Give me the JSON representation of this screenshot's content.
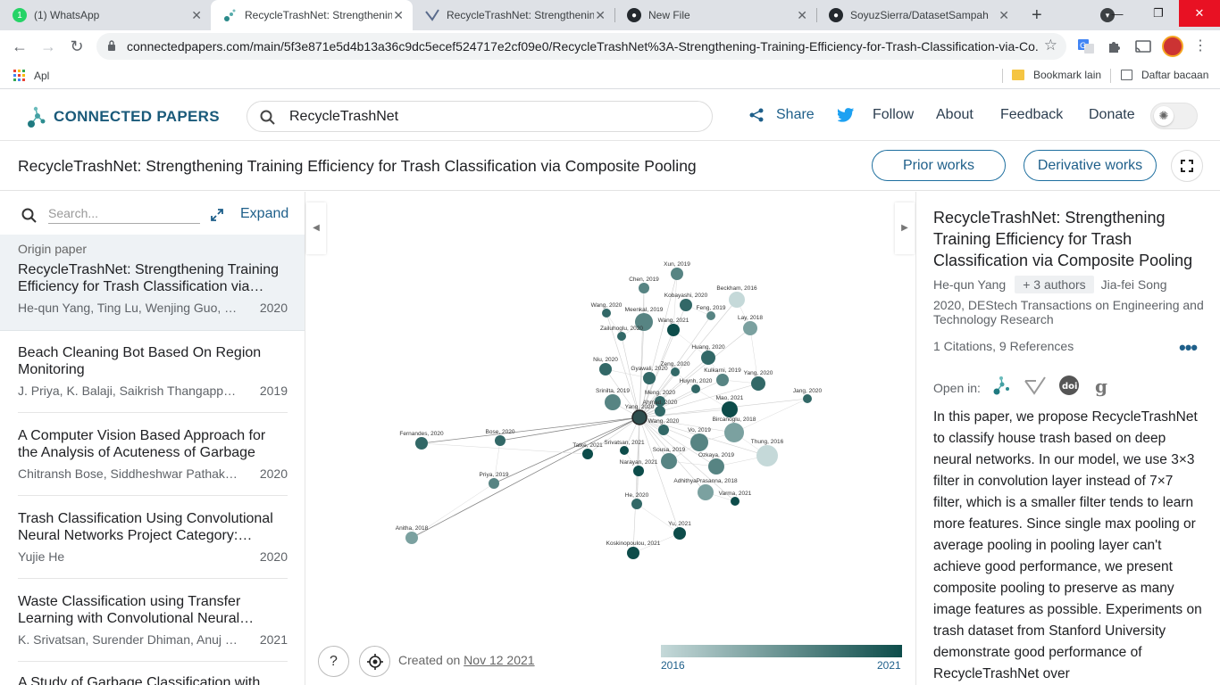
{
  "browser": {
    "tabs": [
      {
        "title": "(1) WhatsApp",
        "badge": "1"
      },
      {
        "title": "RecycleTrashNet: Strengthening"
      },
      {
        "title": "RecycleTrashNet: Strengthening"
      },
      {
        "title": "New File"
      },
      {
        "title": "SoyuzSierra/DatasetSampah"
      }
    ],
    "url": "connectedpapers.com/main/5f3e871e5d4b13a36c9dc5ecef524717e2cf09e0/RecycleTrashNet%3A-Strengthening-Training-Efficiency-for-Trash-Classification-via-Co...",
    "bookmarks": {
      "apps": "Apl",
      "other": "Bookmark lain",
      "reading": "Daftar bacaan"
    }
  },
  "header": {
    "logo": "CONNECTED PAPERS",
    "search_value": "RecycleTrashNet",
    "nav": {
      "share": "Share",
      "follow": "Follow",
      "about": "About",
      "feedback": "Feedback",
      "donate": "Donate"
    }
  },
  "titlebar": {
    "paper_title": "RecycleTrashNet: Strengthening Training Efficiency for Trash Classification via Composite Pooling",
    "prior": "Prior works",
    "derivative": "Derivative works"
  },
  "list": {
    "search_placeholder": "Search...",
    "expand": "Expand",
    "origin_label": "Origin paper",
    "origin": {
      "title": "RecycleTrashNet: Strengthening Training Efficiency for Trash Classification via…",
      "authors": "He-qun Yang, Ting Lu, Wenjing Guo, Shan…",
      "year": "2020"
    },
    "items": [
      {
        "title": "Beach Cleaning Bot Based On Region Monitoring",
        "authors": "J. Priya, K. Balaji, Saikrish Thangappan, G.…",
        "year": "2019"
      },
      {
        "title": "A Computer Vision Based Approach for the Analysis of Acuteness of Garbage",
        "authors": "Chitransh Bose, Siddheshwar Pathak, R.…",
        "year": "2020"
      },
      {
        "title": "Trash Classification Using Convolutional Neural Networks Project Category:…",
        "authors": "Yujie He",
        "year": "2020"
      },
      {
        "title": "Waste Classification using Transfer Learning with Convolutional Neural…",
        "authors": "K. Srivatsan, Surender Dhiman, Anuj K. Jain",
        "year": "2021"
      },
      {
        "title": "A Study of Garbage Classification with",
        "authors": "",
        "year": ""
      }
    ]
  },
  "graph": {
    "created_prefix": "Created on",
    "created_date": "Nov 12 2021",
    "legend_min": "2016",
    "legend_max": "2021",
    "nodes": [
      {
        "label": "Xun, 2019",
        "year": 2019
      },
      {
        "label": "Chen, 2019",
        "year": 2019
      },
      {
        "label": "Beckham, 2016",
        "year": 2016
      },
      {
        "label": "Kobayashi, 2020",
        "year": 2020
      },
      {
        "label": "Wang, 2020",
        "year": 2020
      },
      {
        "label": "Meenkal, 2019",
        "year": 2019
      },
      {
        "label": "Feng, 2019",
        "year": 2019
      },
      {
        "label": "Wang, 2021",
        "year": 2021
      },
      {
        "label": "Lay, 2018",
        "year": 2018
      },
      {
        "label": "Zailuhoglu, 2020",
        "year": 2020
      },
      {
        "label": "Huang, 2020",
        "year": 2020
      },
      {
        "label": "Niu, 2020",
        "year": 2020
      },
      {
        "label": "Zeng, 2020",
        "year": 2020
      },
      {
        "label": "Gyawali, 2020",
        "year": 2020
      },
      {
        "label": "Kulkarni, 2019",
        "year": 2019
      },
      {
        "label": "Yang, 2020",
        "year": 2020
      },
      {
        "label": "Huynh, 2020",
        "year": 2020
      },
      {
        "label": "Srinilta, 2019",
        "year": 2019
      },
      {
        "label": "Meng, 2020",
        "year": 2020
      },
      {
        "label": "Jang, 2020",
        "year": 2020
      },
      {
        "label": "Mao, 2021",
        "year": 2021
      },
      {
        "label": "Ahmad, 2020",
        "year": 2020
      },
      {
        "label": "Yang, 2020",
        "year": 2020
      },
      {
        "label": "Wang, 2020",
        "year": 2020
      },
      {
        "label": "Bircanoglu, 2018",
        "year": 2018
      },
      {
        "label": "Fernandes, 2020",
        "year": 2020
      },
      {
        "label": "Bose, 2020",
        "year": 2020
      },
      {
        "label": "Vo, 2019",
        "year": 2019
      },
      {
        "label": "Tatke, 2021",
        "year": 2021
      },
      {
        "label": "Srivatsan, 2021",
        "year": 2021
      },
      {
        "label": "Thung, 2016",
        "year": 2016
      },
      {
        "label": "Sousa, 2019",
        "year": 2019
      },
      {
        "label": "Ozkaya, 2019",
        "year": 2019
      },
      {
        "label": "Narayan, 2021",
        "year": 2021
      },
      {
        "label": "Priya, 2019",
        "year": 2019
      },
      {
        "label": "AdhithyaPrasanna, 2018",
        "year": 2018
      },
      {
        "label": "Varma, 2021",
        "year": 2021
      },
      {
        "label": "He, 2020",
        "year": 2020
      },
      {
        "label": "Anitha, 2018",
        "year": 2018
      },
      {
        "label": "Yu, 2021",
        "year": 2021
      },
      {
        "label": "Koskinopoulou, 2021",
        "year": 2021
      }
    ]
  },
  "detail": {
    "title": "RecycleTrashNet: Strengthening Training Efficiency for Trash Classification via Composite Pooling",
    "first_author": "He-qun Yang",
    "more_authors": "+ 3 authors",
    "last_author": "Jia-fei Song",
    "venue": "2020, DEStech Transactions on Engineering and Technology Research",
    "citations": "1 Citations, 9 References",
    "open_in": "Open in:",
    "abstract": "In this paper, we propose RecycleTrashNet to classify house trash based on deep neural networks. In our model, we use 3×3 filter in convolution layer instead of 7×7 filter, which is a smaller filter tends to learn more features. Since single max pooling or average pooling in pooling layer can't achieve good performance, we present composite pooling to preserve as many image features as possible. Experiments on trash dataset from Stanford University demonstrate good performance of RecycleTrashNet over"
  },
  "colors": {
    "brand": "#1a5a7a",
    "accent": "#1e5f8a",
    "node_old": "#c5d9d9",
    "node_new": "#0d4c4a"
  }
}
